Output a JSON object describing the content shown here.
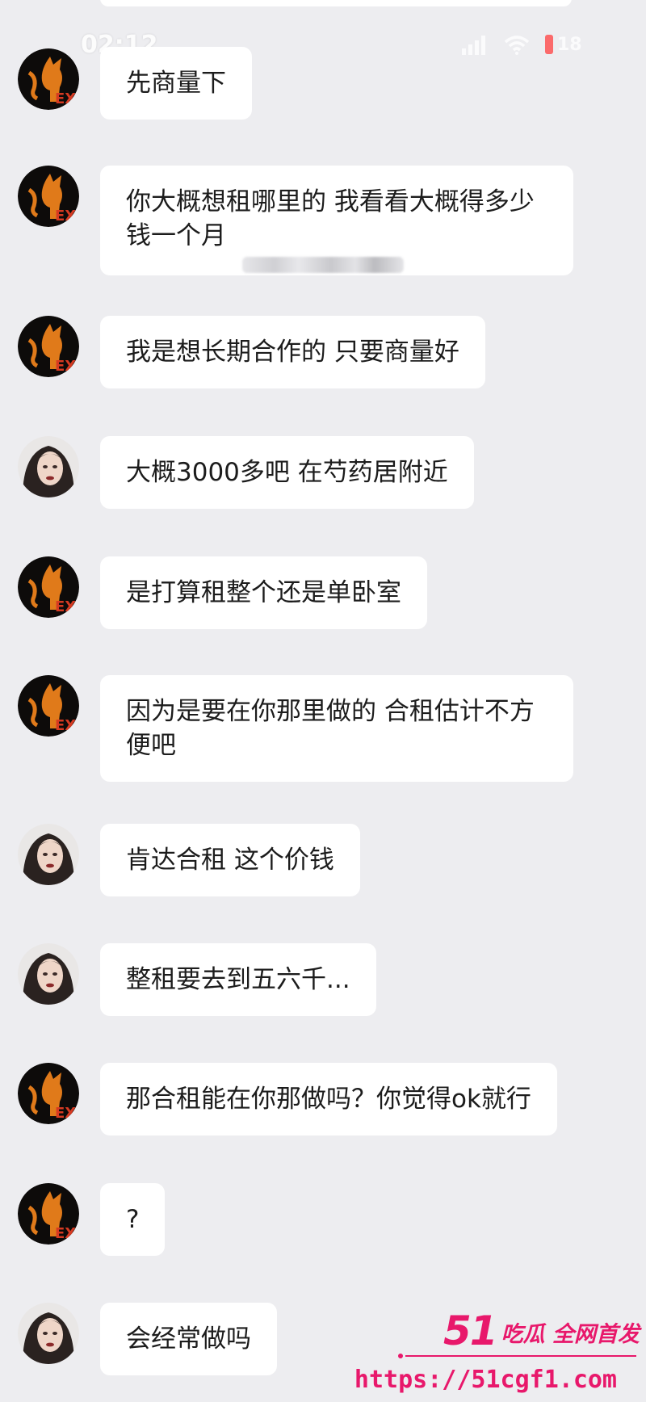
{
  "status_bar": {
    "time": "02:12",
    "icons": [
      "signal-icon",
      "wifi-icon",
      "battery-icon"
    ],
    "battery_label": "18"
  },
  "colors": {
    "background": "#ededf0",
    "bubble": "#ffffff",
    "text": "#1c1c1c",
    "watermark": "#e8186b"
  },
  "messages": [
    {
      "sender": "cat",
      "text": "先商量下"
    },
    {
      "sender": "cat",
      "text": "你大概想租哪里的 我看看大概得多少\n钱一个月",
      "redacted": true
    },
    {
      "sender": "cat",
      "text": "我是想长期合作的 只要商量好"
    },
    {
      "sender": "woman",
      "text": "大概3000多吧 在芍药居附近"
    },
    {
      "sender": "cat",
      "text": "是打算租整个还是单卧室"
    },
    {
      "sender": "cat",
      "text": "因为是要在你那里做的 合租估计不方\n便吧"
    },
    {
      "sender": "woman",
      "text": "肯达合租 这个价钱"
    },
    {
      "sender": "woman",
      "text": "整租要去到五六千..."
    },
    {
      "sender": "cat",
      "text": "那合租能在你那做吗？你觉得ok就行"
    },
    {
      "sender": "cat",
      "text": "?"
    },
    {
      "sender": "woman",
      "text": "会经常做吗"
    }
  ],
  "watermark": {
    "number": "51",
    "tagline": "吃瓜 全网首发",
    "url": "https://51cgf1.com"
  }
}
